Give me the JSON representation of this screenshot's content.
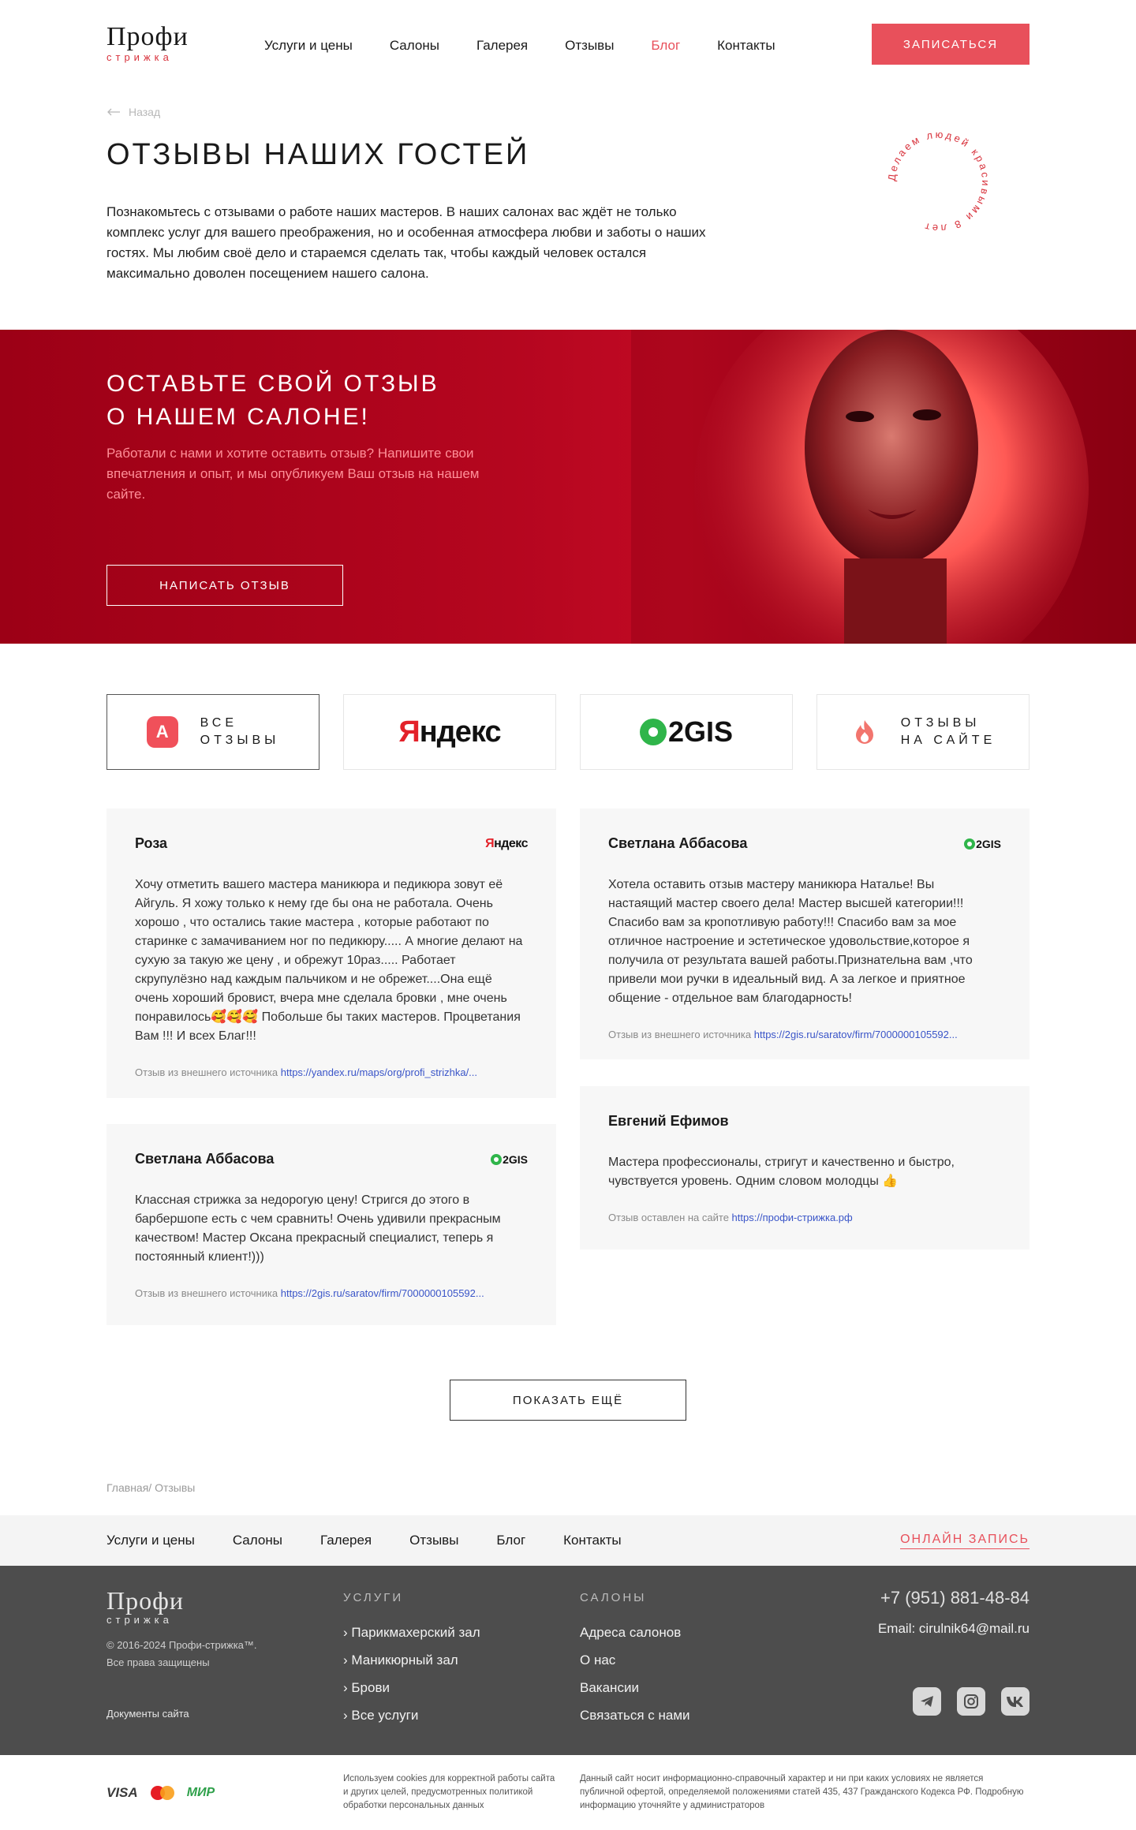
{
  "header": {
    "logo_main": "Профи",
    "logo_sub": "стрижка",
    "nav": [
      "Услуги и цены",
      "Салоны",
      "Галерея",
      "Отзывы",
      "Блог",
      "Контакты"
    ],
    "book_label": "ЗАПИСАТЬСЯ"
  },
  "page": {
    "back_label": "Назад",
    "title": "ОТЗЫВЫ НАШИХ ГОСТЕЙ",
    "intro": "Познакомьтесь с отзывами о работе наших мастеров. В наших салонах вас ждёт не только комплекс услуг для вашего преображения, но и особенная атмосфера любви и заботы о наших гостях. Мы любим своё дело и стараемся сделать так, чтобы каждый человек  остался максимально доволен посещением нашего салона.",
    "ring_text": "Делаем людей красивыми 8 лет"
  },
  "banner": {
    "title_line1": "ОСТАВЬТЕ СВОЙ ОТЗЫВ",
    "title_line2": "О НАШЕМ САЛОНЕ!",
    "text": "Работали с нами и хотите оставить отзыв? Напишите свои впечатления и опыт, и мы опубликуем Ваш отзыв на нашем сайте.",
    "button": "НАПИСАТЬ ОТЗЫВ"
  },
  "filters": {
    "all_line1": "ВСЕ",
    "all_line2": "ОТЗЫВЫ",
    "all_badge": "A",
    "yandex": "Яндекс",
    "gis": "2GIS",
    "site_line1": "ОТЗЫВЫ",
    "site_line2": "НА САЙТЕ"
  },
  "reviews": [
    {
      "name": "Роза",
      "source": "Яндекс",
      "text": "Хочу отметить вашего мастера маникюра и педикюра зовут её Айгуль. Я хожу только к нему где бы она не работала. Очень хорошо , что остались такие мастера , которые работают по старинке с замачиванием ног по педикюру..... А многие делают на сухую за такую же цену , и обрежут 10раз..... Работает скрупулёзно над каждым пальчиком и не обрежет....Она ещё очень хороший бровист, вчера мне сделала бровки , мне очень понравилось🥰🥰🥰 Побольше бы таких мастеров. Процветания Вам !!! И всех Благ!!!",
      "foot_label": "Отзыв из внешнего источника",
      "link": "https://yandex.ru/maps/org/profi_strizhka/..."
    },
    {
      "name": "Светлана Аббасова",
      "source": "2GIS",
      "text": "Хотела оставить отзыв мастеру маникюра Наталье! Вы настаящий мастер своего дела! Мастер высшей категории!!! Спасибо вам за кропотливую работу!!! Спасибо вам за мое отличное настроение и эстетическое удовольствие,которое я получила от результата вашей работы.Признательна вам ,что привели мои ручки в идеальный вид. А за легкое и приятное общение - отдельное вам благодарность!",
      "foot_label": "Отзыв из внешнего источника",
      "link": "https://2gis.ru/saratov/firm/7000000105592..."
    },
    {
      "name": "Евгений Ефимов",
      "source": "",
      "text": "Мастера профессионалы, стригут и качественно и быстро, чувствуется уровень. Одним словом молодцы 👍",
      "foot_label": "Отзыв оставлен на сайте",
      "link": "https://профи-стрижка.рф"
    },
    {
      "name": "Светлана Аббасова",
      "source": "2GIS",
      "text": "Классная стрижка за недорогую цену! Стригся до этого в барбершопе есть с чем сравнить! Очень удивили прекрасным качеством! Мастер Оксана прекрасный специалист, теперь я постоянный клиент!)))",
      "foot_label": "Отзыв из внешнего источника",
      "link": "https://2gis.ru/saratov/firm/7000000105592..."
    }
  ],
  "more_label": "ПОКАЗАТЬ ЕЩЁ",
  "breadcrumbs": "Главная/ Отзывы",
  "footer_nav": {
    "items": [
      "Услуги и цены",
      "Салоны",
      "Галерея",
      "Отзывы",
      "Блог",
      "Контакты"
    ],
    "online": "ОНЛАЙН ЗАПИСЬ"
  },
  "footer": {
    "copyright": "© 2016-2024 Профи-стрижка™.",
    "rights": "Все права защищены",
    "docs": "Документы сайта",
    "services_title": "УСЛУГИ",
    "services": [
      "Парикмахерский зал",
      "Маникюрный зал",
      "Брови",
      "Все услуги"
    ],
    "salons_title": "САЛОНЫ",
    "salons": [
      "Адреса салонов",
      "О нас",
      "Вакансии",
      "Связаться с нами"
    ],
    "phone": "+7 (951) 881-48-84",
    "email": "Email: cirulnik64@mail.ru"
  },
  "bottom": {
    "visa": "VISA",
    "mir": "МИР",
    "cookies": "Используем cookies для корректной работы сайта и других целей, предусмотренных политикой обработки персональных данных",
    "legal": "Данный сайт носит информационно-справочный характер и ни при каких условиях не является публичной офертой, определяемой положениями статей 435, 437 Гражданского Кодекса РФ. Подробную информацию уточняйте у администраторов"
  },
  "colors": {
    "accent": "#e8505b",
    "banner": "#b5061f",
    "footer": "#4d4d4d"
  }
}
